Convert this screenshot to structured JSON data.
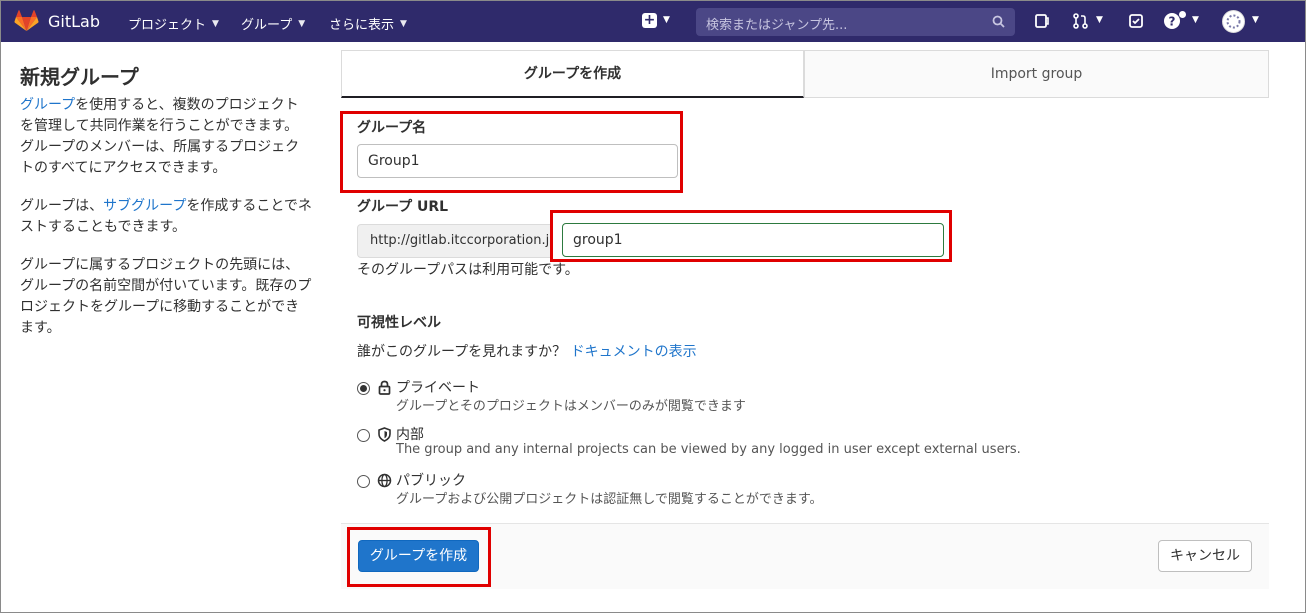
{
  "nav": {
    "brand": "GitLab",
    "projects": "プロジェクト",
    "groups": "グループ",
    "more": "さらに表示",
    "search_placeholder": "検索またはジャンプ先..."
  },
  "sidebar": {
    "title": "新規グループ",
    "p1_link": "グループ",
    "p1_rest": "を使用すると、複数のプロジェクトを管理して共同作業を行うことができます。グループのメンバーは、所属するプロジェクトのすべてにアクセスできます。",
    "p2_before": "グループは、",
    "p2_link": "サブグループ",
    "p2_after": "を作成することでネストすることもできます。",
    "p3": "グループに属するプロジェクトの先頭には、グループの名前空間が付いています。既存のプロジェクトをグループに移動することができます。"
  },
  "tabs": {
    "create": "グループを作成",
    "import": "Import group"
  },
  "form": {
    "name_label": "グループ名",
    "name_value": "Group1",
    "url_label": "グループ URL",
    "url_prefix": "http://gitlab.itccorporation.jp/",
    "url_value": "group1",
    "url_hint": "そのグループパスは利用可能です。",
    "visibility_label": "可視性レベル",
    "visibility_question": "誰がこのグループを見れますか？",
    "docs_link": "ドキュメントの表示",
    "options": [
      {
        "label": "プライベート",
        "desc": "グループとそのプロジェクトはメンバーのみが閲覧できます",
        "checked": true,
        "icon": "lock-icon"
      },
      {
        "label": "内部",
        "desc": "The group and any internal projects can be viewed by any logged in user except external users.",
        "checked": false,
        "icon": "shield-icon"
      },
      {
        "label": "パブリック",
        "desc": "グループおよび公開プロジェクトは認証無しで閲覧することができます。",
        "checked": false,
        "icon": "globe-icon"
      }
    ]
  },
  "footer": {
    "create_button": "グループを作成",
    "cancel_button": "キャンセル"
  },
  "colors": {
    "navbar": "#2f2a6b",
    "primary": "#1f75cb",
    "highlight": "#e00000"
  }
}
